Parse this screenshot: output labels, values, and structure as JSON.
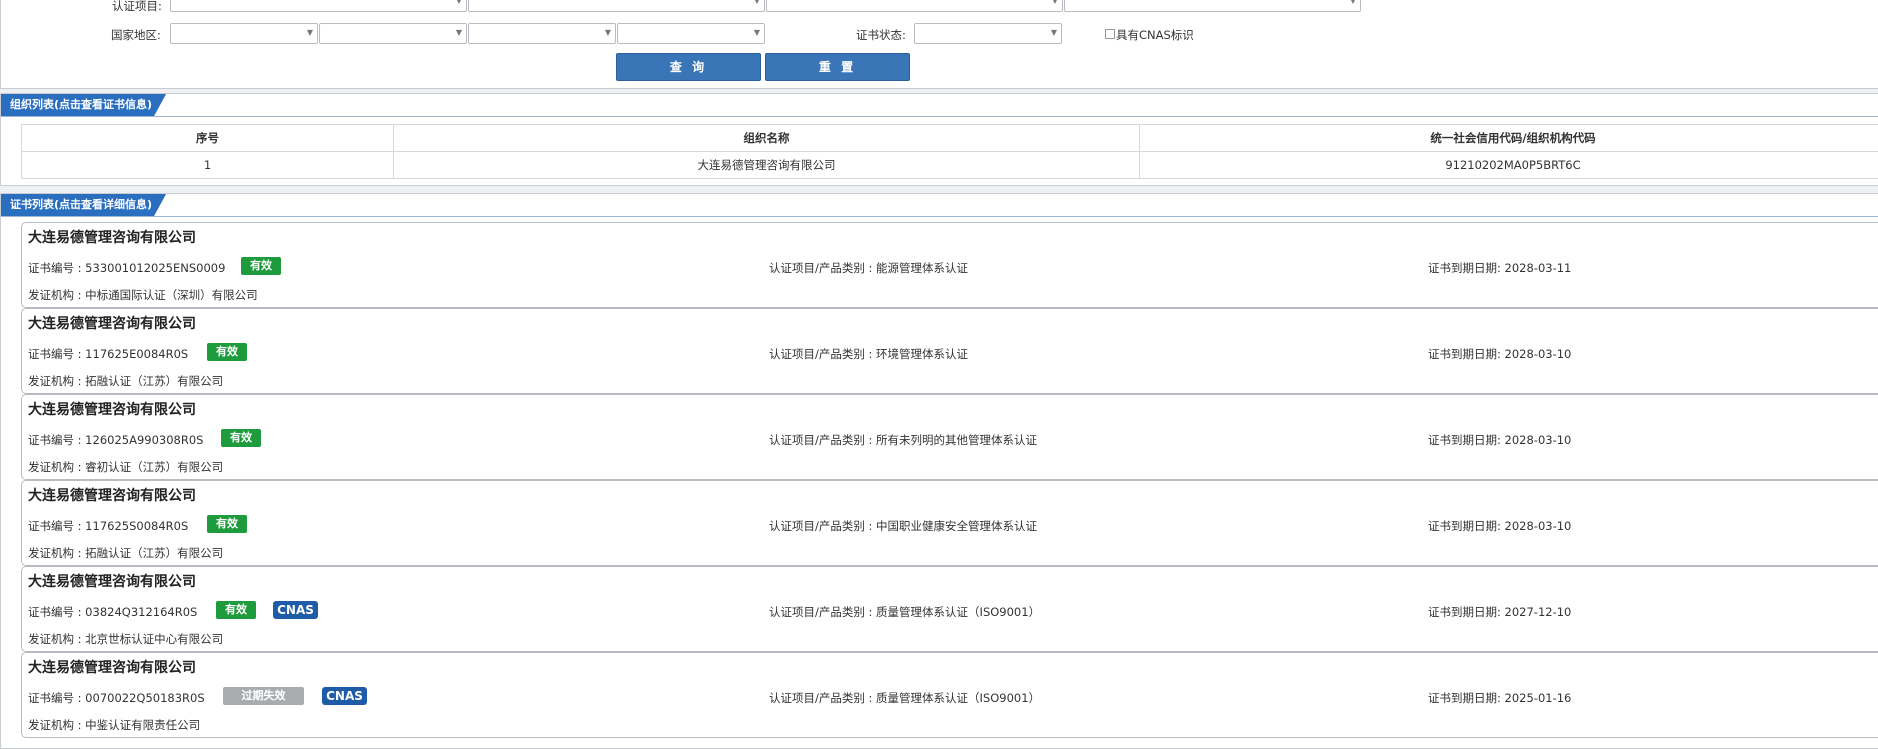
{
  "search": {
    "cert_project_label": "认证项目:",
    "country_label": "国家地区:",
    "cert_status_label": "证书状态:",
    "cnas_checkbox_label": "具有CNAS标识",
    "query_button": "查 询",
    "reset_button": "重 置"
  },
  "org_section": {
    "tab_title": "组织列表(点击查看证书信息)",
    "columns": [
      "序号",
      "组织名称",
      "统一社会信用代码/组织机构代码"
    ],
    "rows": [
      [
        "1",
        "大连易德管理咨询有限公司",
        "91210202MA0P5BRT6C"
      ]
    ]
  },
  "cert_section": {
    "tab_title": "证书列表(点击查看详细信息)",
    "certs": [
      {
        "org": "大连易德管理咨询有限公司",
        "cert_no": "证书编号 : 533001012025ENS0009",
        "status": "有效",
        "cnas": "",
        "project": "认证项目/产品类别 : 能源管理体系认证",
        "expiry": "证书到期日期: 2028-03-11",
        "issuer": "发证机构 : 中标通国际认证（深圳）有限公司"
      },
      {
        "org": "大连易德管理咨询有限公司",
        "cert_no": "证书编号 : 117625E0084R0S",
        "status": "有效",
        "cnas": "",
        "project": "认证项目/产品类别 : 环境管理体系认证",
        "expiry": "证书到期日期: 2028-03-10",
        "issuer": "发证机构 : 拓融认证（江苏）有限公司"
      },
      {
        "org": "大连易德管理咨询有限公司",
        "cert_no": "证书编号 : 126025A990308R0S",
        "status": "有效",
        "cnas": "",
        "project": "认证项目/产品类别 : 所有未列明的其他管理体系认证",
        "expiry": "证书到期日期: 2028-03-10",
        "issuer": "发证机构 : 睿初认证（江苏）有限公司"
      },
      {
        "org": "大连易德管理咨询有限公司",
        "cert_no": "证书编号 : 117625S0084R0S",
        "status": "有效",
        "cnas": "",
        "project": "认证项目/产品类别 : 中国职业健康安全管理体系认证",
        "expiry": "证书到期日期: 2028-03-10",
        "issuer": "发证机构 : 拓融认证（江苏）有限公司"
      },
      {
        "org": "大连易德管理咨询有限公司",
        "cert_no": "证书编号 : 03824Q312164R0S",
        "status": "有效",
        "cnas": "CNAS",
        "project": "认证项目/产品类别 : 质量管理体系认证（ISO9001）",
        "expiry": "证书到期日期: 2027-12-10",
        "issuer": "发证机构 : 北京世标认证中心有限公司"
      },
      {
        "org": "大连易德管理咨询有限公司",
        "cert_no": "证书编号 : 0070022Q50183R0S",
        "status": "过期失效",
        "cnas": "CNAS",
        "project": "认证项目/产品类别 : 质量管理体系认证（ISO9001）",
        "expiry": "证书到期日期: 2025-01-16",
        "issuer": "发证机构 : 中鉴认证有限责任公司"
      }
    ]
  },
  "colors": {
    "primary_button": "#3a75b8",
    "tab_blue": "#2a6ebf",
    "valid_badge": "#1e9b3c",
    "expired_badge": "#a9acaf",
    "cnas_badge": "#1f5ca8"
  }
}
